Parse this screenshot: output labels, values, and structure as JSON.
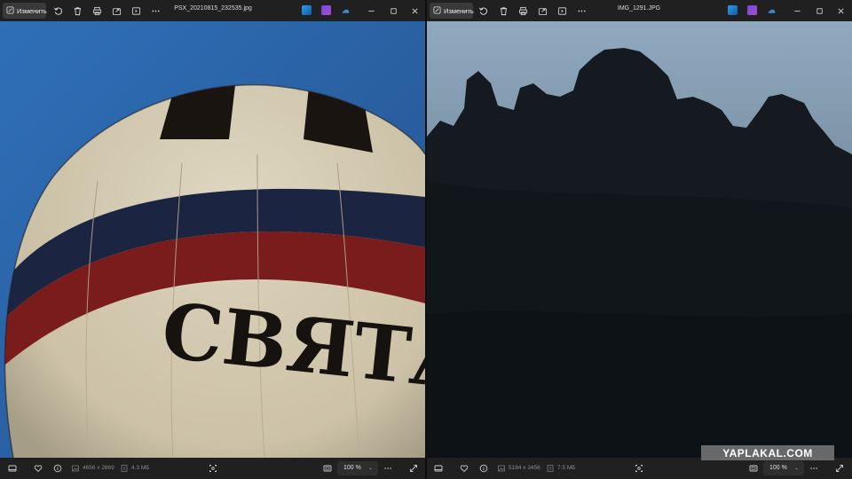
{
  "left_window": {
    "edit_label": "Изменить",
    "filename": "PSX_20210815_232535.jpg",
    "dimensions": "4656 x 2869",
    "filesize": "4.3 МБ",
    "zoom": "100 %",
    "photo_text": "СВЯТА"
  },
  "right_window": {
    "edit_label": "Изменить",
    "filename": "IMG_1291.JPG",
    "dimensions": "5184 x 3456",
    "filesize": "7.5 МБ",
    "zoom": "100 %"
  },
  "watermark": "YAPLAKAL.COM",
  "colors": {
    "titlebar": "#202020",
    "sky_left": "#2f64a8",
    "sky_right": "#8aa4bb",
    "balloon_cream": "#d8cfb6",
    "balloon_navy": "#1a2340",
    "balloon_red": "#7e1d1d"
  },
  "icons": {
    "titlebar": [
      "edit-icon",
      "rotate-icon",
      "delete-icon",
      "print-icon",
      "share-icon",
      "slideshow-icon",
      "more-icon",
      "photoshop-icon",
      "clipchamp-icon",
      "onedrive-icon",
      "minimize-icon",
      "maximize-icon",
      "close-icon"
    ],
    "statusbar": [
      "filmstrip-icon",
      "favorite-icon",
      "info-icon",
      "image-size-icon",
      "file-size-icon",
      "focus-icon",
      "fit-icon",
      "more-icon",
      "fullscreen-icon"
    ]
  }
}
